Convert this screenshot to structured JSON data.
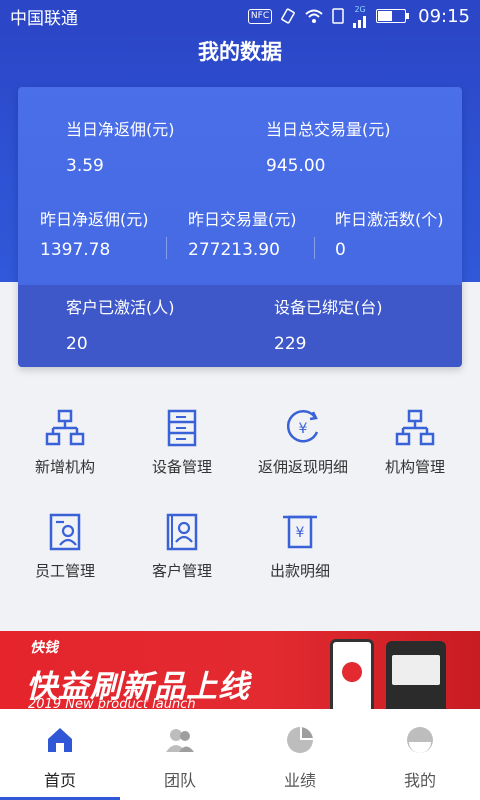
{
  "status_bar": {
    "carrier": "中国联通",
    "nfc": "NFC",
    "network": "2G",
    "time": "09:15"
  },
  "header": {
    "title": "我的数据"
  },
  "stats": {
    "today_rebate_label": "当日净返佣(元)",
    "today_rebate_value": "3.59",
    "today_volume_label": "当日总交易量(元)",
    "today_volume_value": "945.00",
    "yesterday_rebate_label": "昨日净返佣(元)",
    "yesterday_rebate_value": "1397.78",
    "yesterday_volume_label": "昨日交易量(元)",
    "yesterday_volume_value": "277213.90",
    "yesterday_activations_label": "昨日激活数(个)",
    "yesterday_activations_value": "0",
    "customers_activated_label": "客户已激活(人)",
    "customers_activated_value": "20",
    "devices_bound_label": "设备已绑定(台)",
    "devices_bound_value": "229"
  },
  "menu": [
    {
      "label": "新增机构",
      "icon": "org-chart-icon"
    },
    {
      "label": "设备管理",
      "icon": "device-rack-icon"
    },
    {
      "label": "返佣返现明细",
      "icon": "rebate-icon"
    },
    {
      "label": "机构管理",
      "icon": "org-chart-icon"
    },
    {
      "label": "员工管理",
      "icon": "employee-card-icon"
    },
    {
      "label": "客户管理",
      "icon": "customer-book-icon"
    },
    {
      "label": "出款明细",
      "icon": "payout-icon"
    }
  ],
  "banner": {
    "brand": "快钱",
    "headline": "快益刷新品上线",
    "subtitle": "2019 New product launch"
  },
  "tabs": [
    {
      "label": "首页",
      "icon": "home-icon",
      "active": true
    },
    {
      "label": "团队",
      "icon": "team-icon",
      "active": false
    },
    {
      "label": "业绩",
      "icon": "pie-chart-icon",
      "active": false
    },
    {
      "label": "我的",
      "icon": "profile-icon",
      "active": false
    }
  ],
  "colors": {
    "primary_blue": "#2b47c8",
    "card_blue": "#4a6fe8",
    "icon_blue": "#3a62d8",
    "banner_red": "#e32a31"
  }
}
